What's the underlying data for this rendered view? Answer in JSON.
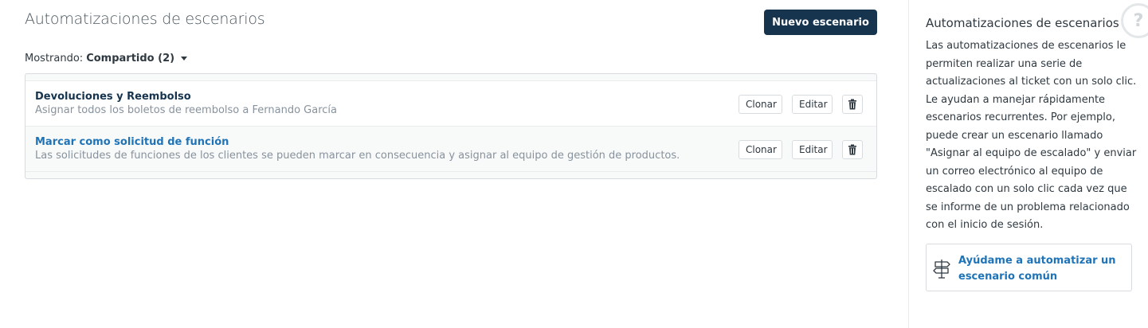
{
  "main": {
    "title": "Automatizaciones de escenarios",
    "new_button": "Nuevo escenario",
    "filter": {
      "label": "Mostrando:",
      "value": "Compartido (2)"
    },
    "rows": [
      {
        "title": "Devoluciones y Reembolso",
        "description": "Asignar todos los boletos de reembolso a Fernando García",
        "clone_label": "Clonar",
        "edit_label": "Editar"
      },
      {
        "title": "Marcar como solicitud de función",
        "description": "Las solicitudes de funciones de los clientes se pueden marcar en consecuencia y asignar al equipo de gestión de productos.",
        "clone_label": "Clonar",
        "edit_label": "Editar"
      }
    ]
  },
  "sidebar": {
    "title": "Automatizaciones de escenarios",
    "help_icon": "?",
    "body": "Las automatizaciones de escenarios le permiten realizar una serie de actualizaciones al ticket con un solo clic. Le ayudan a manejar rápidamente escenarios recurrentes. Por ejemplo, puede crear un escenario llamado \"Asignar al equipo de escalado\" y enviar un correo electrónico al equipo de escalado con un solo clic cada vez que se informe de un problema relacionado con el inicio de sesión.",
    "help_link": "Ayúdame a automatizar un escenario común"
  },
  "colors": {
    "primary_button": "#17344f",
    "link": "#1f73b7",
    "muted_text": "#87929d"
  },
  "icons": [
    "caret-down-icon",
    "trash-icon",
    "help-icon",
    "signpost-icon"
  ]
}
